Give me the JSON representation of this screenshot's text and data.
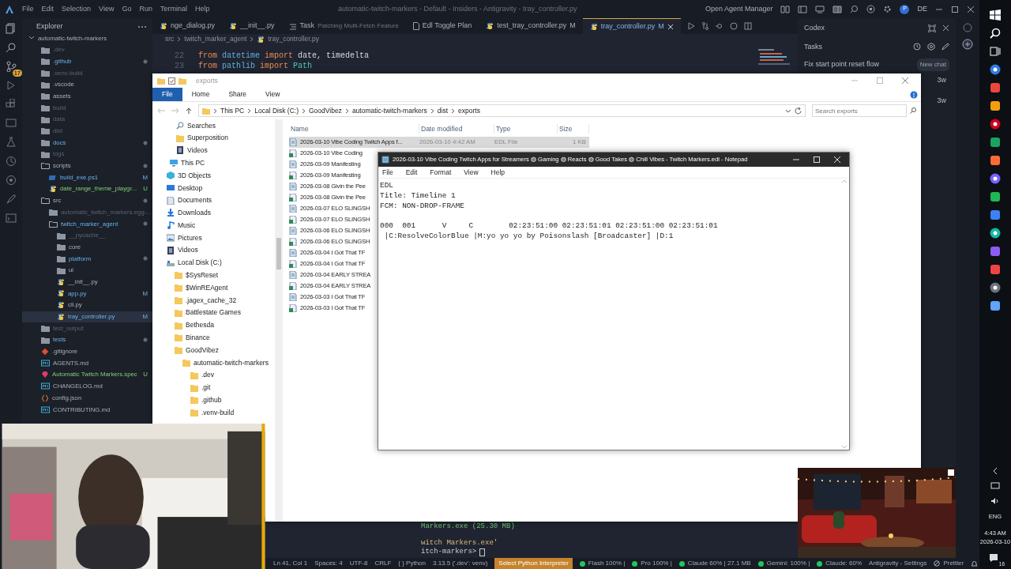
{
  "vscode": {
    "title": "automatic-twitch-markers - Default - Insiders - Antigravity - tray_controller.py",
    "menu": [
      "File",
      "Edit",
      "Selection",
      "View",
      "Go",
      "Run",
      "Terminal",
      "Help"
    ],
    "agent_manager": "Open Agent Manager",
    "avatar": "P",
    "profile": "DE",
    "scm_badge": "17",
    "explorer_title": "Explorer",
    "tree": [
      {
        "name": "automatic-twitch-markers",
        "kind": "root",
        "expanded": true,
        "ignored": false,
        "changed": false,
        "selected": false,
        "children": [
          {
            "name": ".dev",
            "kind": "folder",
            "expanded": false,
            "ignored": true,
            "changed": false,
            "selected": false
          },
          {
            "name": ".github",
            "kind": "folder",
            "expanded": false,
            "ignored": false,
            "changed": true,
            "dot": true,
            "selected": false
          },
          {
            "name": ".venv-build",
            "kind": "folder",
            "expanded": false,
            "ignored": true,
            "changed": false,
            "selected": false
          },
          {
            "name": ".vscode",
            "kind": "folder",
            "expanded": false,
            "ignored": false,
            "changed": false,
            "selected": false
          },
          {
            "name": "assets",
            "kind": "folder",
            "expanded": false,
            "ignored": false,
            "changed": false,
            "selected": false
          },
          {
            "name": "build",
            "kind": "folder",
            "expanded": false,
            "ignored": true,
            "changed": false,
            "selected": false
          },
          {
            "name": "data",
            "kind": "folder",
            "expanded": false,
            "ignored": true,
            "changed": false,
            "selected": false
          },
          {
            "name": "dist",
            "kind": "folder",
            "expanded": false,
            "ignored": true,
            "changed": false,
            "selected": false
          },
          {
            "name": "docs",
            "kind": "folder",
            "expanded": false,
            "ignored": false,
            "changed": true,
            "dot": true,
            "selected": false
          },
          {
            "name": "logs",
            "kind": "folder",
            "expanded": false,
            "ignored": true,
            "changed": false,
            "selected": false
          },
          {
            "name": "scripts",
            "kind": "folder",
            "expanded": true,
            "ignored": false,
            "changed": false,
            "dot": true,
            "selected": false,
            "children": [
              {
                "name": "build_exe.ps1",
                "kind": "script",
                "ignored": false,
                "changed": true,
                "badge": "M",
                "selected": false
              },
              {
                "name": "date_range_theme_playgr...",
                "kind": "python",
                "ignored": false,
                "changed": false,
                "untracked": true,
                "badge": "U",
                "selected": false
              }
            ]
          },
          {
            "name": "src",
            "kind": "folder",
            "expanded": true,
            "ignored": false,
            "changed": false,
            "dot": true,
            "selected": false,
            "children": [
              {
                "name": "automatic_twitch_markers.egg-...",
                "kind": "folder",
                "expanded": false,
                "ignored": true,
                "changed": false,
                "selected": false
              },
              {
                "name": "twitch_marker_agent",
                "kind": "folder",
                "expanded": true,
                "ignored": false,
                "changed": true,
                "dot": true,
                "selected": false,
                "children": [
                  {
                    "name": "__pycache__",
                    "kind": "folder",
                    "expanded": false,
                    "ignored": true,
                    "changed": false,
                    "selected": false
                  },
                  {
                    "name": "core",
                    "kind": "folder",
                    "expanded": false,
                    "ignored": false,
                    "changed": false,
                    "selected": false
                  },
                  {
                    "name": "platform",
                    "kind": "folder",
                    "expanded": false,
                    "ignored": false,
                    "changed": true,
                    "dot": true,
                    "selected": false
                  },
                  {
                    "name": "ui",
                    "kind": "folder",
                    "expanded": false,
                    "ignored": false,
                    "changed": false,
                    "selected": false
                  },
                  {
                    "name": "__init__.py",
                    "kind": "python",
                    "ignored": false,
                    "changed": false,
                    "selected": false
                  },
                  {
                    "name": "app.py",
                    "kind": "python",
                    "ignored": false,
                    "changed": true,
                    "badge": "M",
                    "selected": false
                  },
                  {
                    "name": "cli.py",
                    "kind": "python",
                    "ignored": false,
                    "changed": false,
                    "selected": false
                  },
                  {
                    "name": "tray_controller.py",
                    "kind": "python",
                    "ignored": false,
                    "changed": true,
                    "badge": "M",
                    "selected": true
                  }
                ]
              }
            ]
          },
          {
            "name": "test_output",
            "kind": "folder",
            "expanded": false,
            "ignored": true,
            "changed": false,
            "selected": false
          },
          {
            "name": "tests",
            "kind": "folder",
            "expanded": false,
            "ignored": false,
            "changed": true,
            "dot": true,
            "selected": false
          },
          {
            "name": ".gitignore",
            "kind": "gitignore",
            "ignored": false,
            "changed": false,
            "selected": false
          },
          {
            "name": "AGENTS.md",
            "kind": "markdown",
            "ignored": false,
            "changed": false,
            "selected": false
          },
          {
            "name": "Automatic Twitch Markers.spec",
            "kind": "spec",
            "ignored": false,
            "changed": false,
            "untracked": true,
            "badge": "U",
            "selected": false
          },
          {
            "name": "CHANGELOG.md",
            "kind": "markdown",
            "ignored": false,
            "changed": false,
            "selected": false
          },
          {
            "name": "config.json",
            "kind": "json",
            "ignored": false,
            "changed": false,
            "selected": false
          },
          {
            "name": "CONTRIBUTING.md",
            "kind": "markdown",
            "ignored": false,
            "changed": false,
            "selected": false
          }
        ]
      }
    ],
    "tabs": [
      {
        "label": "nge_dialog.py",
        "kind": "python",
        "selected": false
      },
      {
        "label": "__init__.py",
        "kind": "python",
        "selected": false
      },
      {
        "label": "Task",
        "description": "Patching Multi-Fetch Feature",
        "kind": "task",
        "selected": false
      },
      {
        "label": "Edl Toggle Plan",
        "kind": "doc",
        "selected": false
      },
      {
        "label": "test_tray_controller.py",
        "badge": "M",
        "kind": "python",
        "selected": false
      },
      {
        "label": "tray_controller.py",
        "badge": "M",
        "kind": "python",
        "selected": true
      }
    ],
    "breadcrumb": [
      "src",
      "twitch_marker_agent",
      "tray_controller.py"
    ],
    "code": [
      {
        "line": "22",
        "tokens": [
          {
            "text": "from",
            "kind": "keyword"
          },
          {
            "text": "datetime",
            "kind": "module"
          },
          {
            "text": "import",
            "kind": "keyword"
          },
          {
            "text": "date, timedelta",
            "kind": "name"
          }
        ]
      },
      {
        "line": "23",
        "tokens": [
          {
            "text": "from",
            "kind": "keyword"
          },
          {
            "text": "pathlib",
            "kind": "module"
          },
          {
            "text": "import",
            "kind": "keyword"
          },
          {
            "text": "Path",
            "kind": "class"
          }
        ]
      }
    ],
    "terminal": [
      {
        "text": "Markers.exe (25.30 MB)",
        "kind": "success"
      },
      {
        "text": "witch Markers.exe'",
        "kind": "string"
      },
      {
        "text": "itch-markers>",
        "kind": "prompt"
      }
    ],
    "codex": {
      "title": "Codex",
      "section": "Tasks",
      "tasks": [
        "Fix start point reset flow"
      ],
      "tooltip": "New chat",
      "ages": [
        "3w",
        "3w"
      ]
    },
    "status_bar": [
      {
        "text": "Ln 41, Col 1",
        "kind": "plain"
      },
      {
        "text": "Spaces: 4",
        "kind": "plain"
      },
      {
        "text": "UTF-8",
        "kind": "plain"
      },
      {
        "text": "CRLF",
        "kind": "plain"
      },
      {
        "text": "{ } Python",
        "kind": "plain"
      },
      {
        "text": "3.13.5 ('.dev': venv)",
        "kind": "plain"
      },
      {
        "text": "Select Python Interpreter",
        "kind": "accent"
      },
      {
        "text": "Flash 100% |",
        "kind": "dot"
      },
      {
        "text": "Pro 100% |",
        "kind": "dot"
      },
      {
        "text": "Claude 60% | 27.1 MB",
        "kind": "dot"
      },
      {
        "text": "Gemini: 100% |",
        "kind": "dot"
      },
      {
        "text": "Claude: 60%",
        "kind": "dot"
      },
      {
        "text": "Antigravity - Settings",
        "kind": "plain"
      },
      {
        "text": "Prettier",
        "kind": "blocked"
      }
    ]
  },
  "file_explorer": {
    "title": "exports",
    "ribbon": [
      {
        "label": "File",
        "selected": true
      },
      {
        "label": "Home",
        "selected": false
      },
      {
        "label": "Share",
        "selected": false
      },
      {
        "label": "View",
        "selected": false
      }
    ],
    "address": [
      "This PC",
      "Local Disk (C:)",
      "GoodVibez",
      "automatic-twitch-markers",
      "dist",
      "exports"
    ],
    "search": {
      "placeholder": "Search exports"
    },
    "nav": [
      {
        "label": "Searches",
        "kind": "search"
      },
      {
        "label": "Superposition",
        "kind": "folder"
      },
      {
        "label": "Videos",
        "kind": "video"
      },
      {
        "label": "This PC",
        "kind": "pc",
        "children": [
          {
            "label": "3D Objects",
            "kind": "cube"
          },
          {
            "label": "Desktop",
            "kind": "desktop"
          },
          {
            "label": "Documents",
            "kind": "document"
          },
          {
            "label": "Downloads",
            "kind": "download"
          },
          {
            "label": "Music",
            "kind": "music"
          },
          {
            "label": "Pictures",
            "kind": "picture"
          },
          {
            "label": "Videos",
            "kind": "video"
          },
          {
            "label": "Local Disk (C:)",
            "kind": "drive",
            "children": [
              {
                "label": "$SysReset",
                "kind": "folder"
              },
              {
                "label": "$WinREAgent",
                "kind": "folder"
              },
              {
                "label": ".jagex_cache_32",
                "kind": "folder"
              },
              {
                "label": "Battlestate Games",
                "kind": "folder"
              },
              {
                "label": "Bethesda",
                "kind": "folder"
              },
              {
                "label": "Binance",
                "kind": "folder"
              },
              {
                "label": "GoodVibez",
                "kind": "folder",
                "children": [
                  {
                    "label": "automatic-twitch-markers",
                    "kind": "folder",
                    "children": [
                      {
                        "label": ".dev",
                        "kind": "folder"
                      },
                      {
                        "label": ".git",
                        "kind": "folder"
                      },
                      {
                        "label": ".github",
                        "kind": "folder"
                      },
                      {
                        "label": ".venv-build",
                        "kind": "folder"
                      }
                    ]
                  }
                ]
              }
            ]
          }
        ]
      }
    ],
    "columns": [
      "Name",
      "Date modified",
      "Type",
      "Size"
    ],
    "rows": [
      {
        "name": "2026-03-10 Vibe Coding Twitch Apps f...",
        "date": "2026-03-10 4:42 AM",
        "type": "EDL File",
        "size": "1 KB",
        "kind": "text",
        "selected": true
      },
      {
        "name": "2026-03-10 Vibe Coding",
        "kind": "media",
        "selected": false
      },
      {
        "name": "2026-03-09 Manifesting",
        "kind": "text",
        "selected": false
      },
      {
        "name": "2026-03-09 Manifesting",
        "kind": "media",
        "selected": false
      },
      {
        "name": "2026-03-08 Givin the Pee",
        "kind": "text",
        "selected": false
      },
      {
        "name": "2026-03-08 Givin the Pee",
        "kind": "media",
        "selected": false
      },
      {
        "name": "2026-03-07 ELO SLINGSH",
        "kind": "text",
        "selected": false
      },
      {
        "name": "2026-03-07 ELO SLINGSH",
        "kind": "media",
        "selected": false
      },
      {
        "name": "2026-03-06 ELO SLINGSH",
        "kind": "text",
        "selected": false
      },
      {
        "name": "2026-03-06 ELO SLINGSH",
        "kind": "media",
        "selected": false
      },
      {
        "name": "2026-03-04 I Got That TF",
        "kind": "text",
        "selected": false
      },
      {
        "name": "2026-03-04 I Got That TF",
        "kind": "media",
        "selected": false
      },
      {
        "name": "2026-03-04 EARLY STREA",
        "kind": "text",
        "selected": false
      },
      {
        "name": "2026-03-04 EARLY STREA",
        "kind": "media",
        "selected": false
      },
      {
        "name": "2026-03-03 I Got That TF",
        "kind": "text",
        "selected": false
      },
      {
        "name": "2026-03-03 I Got That TF",
        "kind": "media",
        "selected": false
      }
    ]
  },
  "notepad": {
    "title": "2026-03-10 Vibe Coding Twitch Apps for Streamers ◍ Gaming ◍ Reacts ◍ Good Takes ◍ Chill Vibes - Twitch Markers.edl - Notepad",
    "menu": [
      "File",
      "Edit",
      "Format",
      "View",
      "Help"
    ],
    "blocks": [
      [
        "EDL",
        "Title: Timeline 1",
        "FCM: NON-DROP-FRAME"
      ],
      [
        "000  001      V     C        02:23:51:00 02:23:51:01 02:23:51:00 02:23:51:01",
        " |C:ResolveColorBlue |M:yo yo yo by Poisonslash [Broadcaster] |D:1"
      ]
    ]
  },
  "taskbar": {
    "language": "ENG",
    "time": "4:43 AM",
    "date": "2026-03-10",
    "notifications": "16"
  }
}
